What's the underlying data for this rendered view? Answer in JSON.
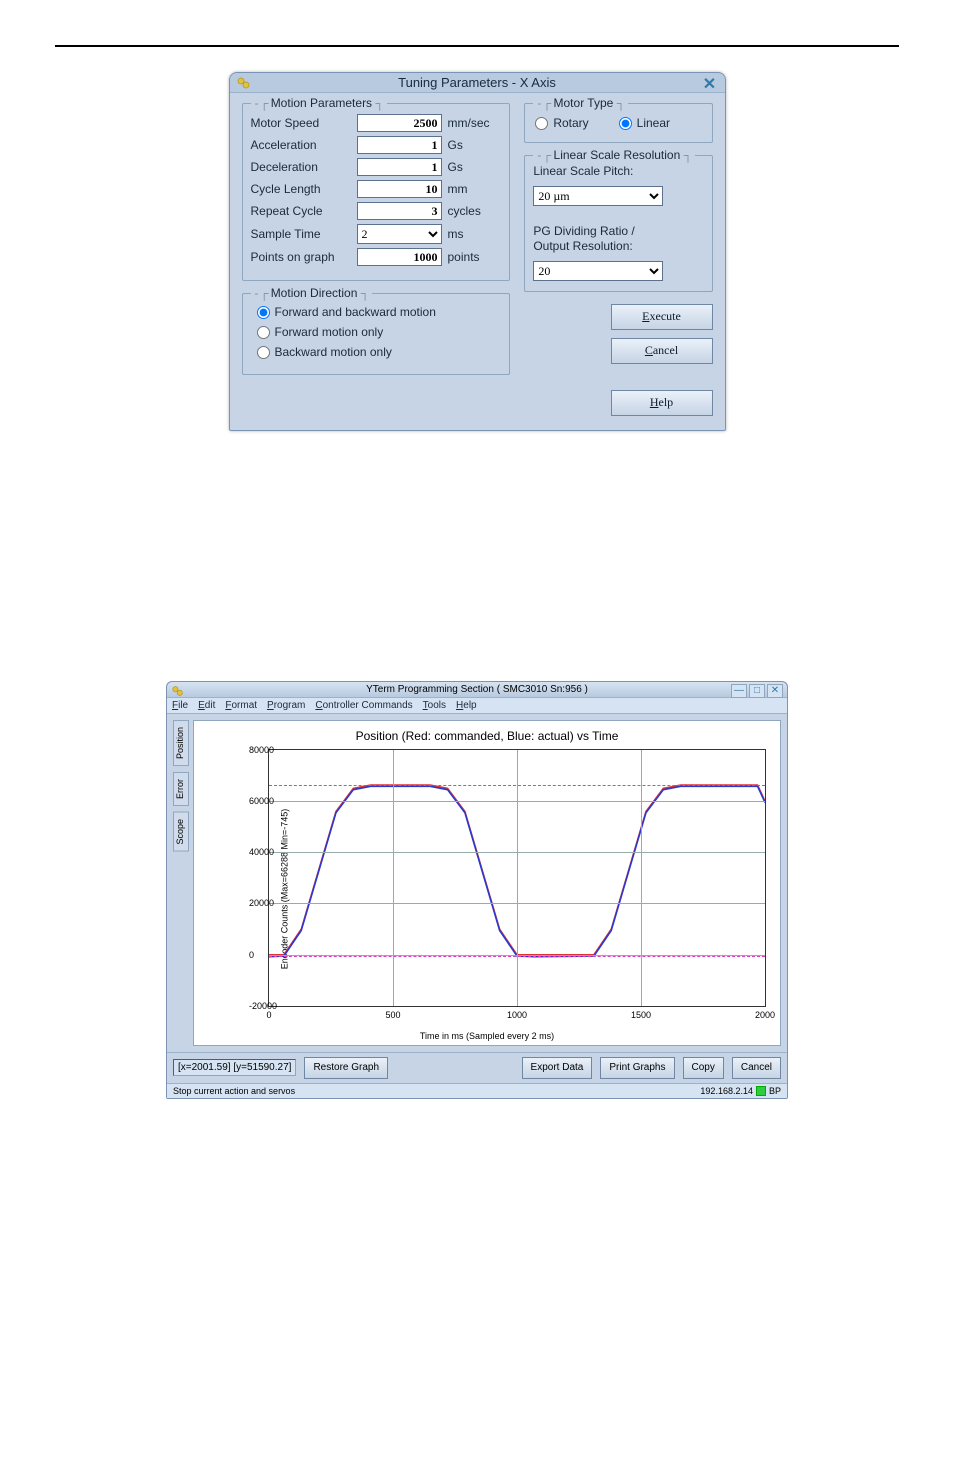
{
  "dialog": {
    "title": "Tuning Parameters - X Axis",
    "motion_params": {
      "legend": "Motion Parameters",
      "motor_speed": {
        "label": "Motor Speed",
        "value": "2500",
        "unit": "mm/sec"
      },
      "acceleration": {
        "label": "Acceleration",
        "value": "1",
        "unit": "Gs"
      },
      "deceleration": {
        "label": "Deceleration",
        "value": "1",
        "unit": "Gs"
      },
      "cycle_length": {
        "label": "Cycle Length",
        "value": "10",
        "unit": "mm"
      },
      "repeat_cycle": {
        "label": "Repeat Cycle",
        "value": "3",
        "unit": "cycles"
      },
      "sample_time": {
        "label": "Sample Time",
        "value": "2",
        "unit": "ms"
      },
      "points_on_graph": {
        "label": "Points on graph",
        "value": "1000",
        "unit": "points"
      }
    },
    "motion_dir": {
      "legend": "Motion Direction",
      "opt_both": "Forward and backward motion",
      "opt_fwd": "Forward motion only",
      "opt_bwd": "Backward motion only",
      "selected": "both"
    },
    "motor_type": {
      "legend": "Motor Type",
      "opt_rotary": "Rotary",
      "opt_linear": "Linear",
      "selected": "linear"
    },
    "linear_scale": {
      "legend": "Linear Scale Resolution",
      "pitch_label": "Linear Scale Pitch:",
      "pitch_value": "20 µm",
      "ratio_label": "PG Dividing Ratio /\nOutput Resolution:",
      "ratio_value": "20"
    },
    "buttons": {
      "execute": "Execute",
      "cancel": "Cancel",
      "help": "Help"
    }
  },
  "chart_window": {
    "title": "YTerm Programming Section ( SMC3010 Sn:956 )",
    "menu": [
      "File",
      "Edit",
      "Format",
      "Program",
      "Controller Commands",
      "Tools",
      "Help"
    ],
    "side_tabs": [
      "Position",
      "Error",
      "Scope"
    ],
    "btnbar": {
      "coord": "[x=2001.59] [y=51590.27]",
      "restore": "Restore Graph",
      "export": "Export Data",
      "print": "Print Graphs",
      "copy": "Copy",
      "cancel": "Cancel"
    },
    "status": {
      "left": "Stop current action and servos",
      "ip": "192.168.2.14",
      "mode": "BP"
    }
  },
  "chart_data": {
    "type": "line",
    "title": "Position (Red: commanded, Blue: actual) vs Time",
    "xlabel": "Time in ms (Sampled every 2 ms)",
    "ylabel": "Encoder Counts (Max=66288 Min=-745)",
    "xlim": [
      0,
      2000
    ],
    "ylim": [
      -20000,
      80000
    ],
    "xticks": [
      0,
      500,
      1000,
      1500,
      2000
    ],
    "yticks": [
      -20000,
      0,
      20000,
      40000,
      60000,
      80000
    ],
    "reference_lines": [
      {
        "axis": "y",
        "value": 66288,
        "style": "dashed",
        "color": "#d63fbf"
      },
      {
        "axis": "y",
        "value": -745,
        "style": "dashed",
        "color": "#d63fbf"
      }
    ],
    "series": [
      {
        "name": "Commanded",
        "color": "#e03030",
        "x": [
          0,
          60,
          130,
          200,
          270,
          340,
          410,
          650,
          720,
          790,
          860,
          930,
          1000,
          1070,
          1310,
          1380,
          1450,
          1520,
          1590,
          1660,
          1730,
          1970,
          2000
        ],
        "y": [
          0,
          0,
          10000,
          33000,
          56000,
          65000,
          66288,
          66288,
          65000,
          56000,
          33000,
          10000,
          0,
          0,
          0,
          10000,
          33000,
          56000,
          65000,
          66288,
          66288,
          66288,
          60000
        ]
      },
      {
        "name": "Actual",
        "color": "#2838d0",
        "x": [
          0,
          60,
          130,
          200,
          270,
          340,
          410,
          650,
          720,
          790,
          860,
          930,
          1000,
          1070,
          1310,
          1380,
          1450,
          1520,
          1590,
          1660,
          1730,
          1970,
          2000
        ],
        "y": [
          -745,
          -500,
          9500,
          32500,
          55500,
          64500,
          65800,
          65800,
          64500,
          55500,
          32500,
          9500,
          -500,
          -745,
          -500,
          9500,
          32500,
          55500,
          64500,
          65800,
          65800,
          65800,
          59500
        ]
      }
    ]
  }
}
